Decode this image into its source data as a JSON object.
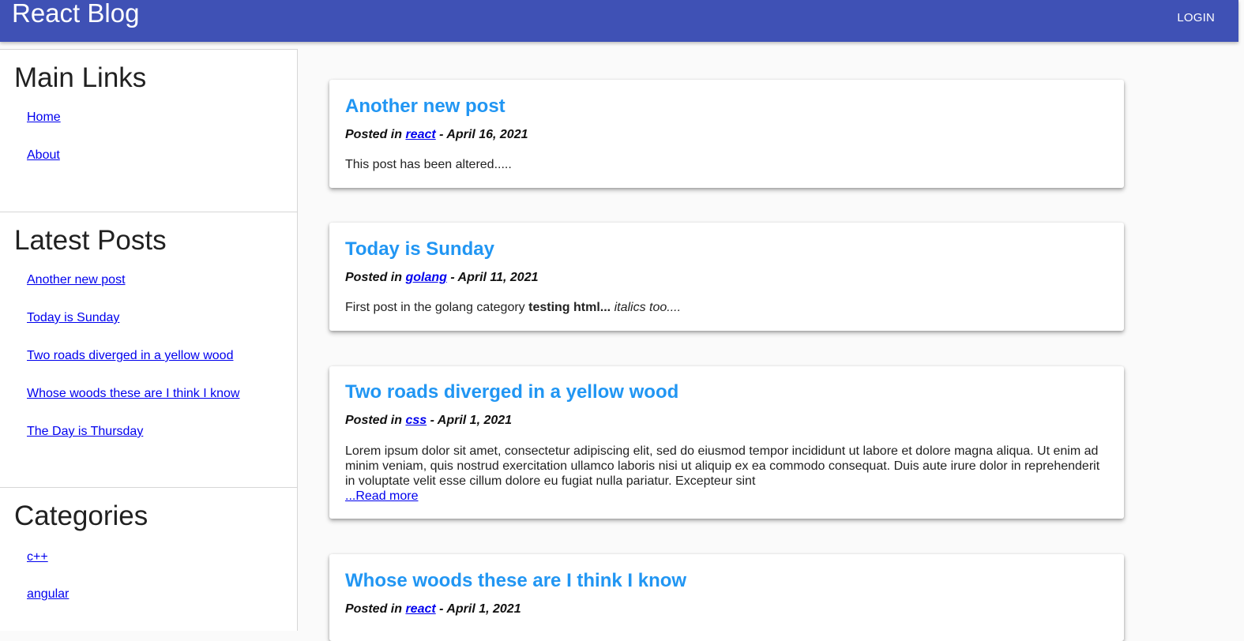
{
  "appbar": {
    "title": "React Blog",
    "login_label": "LOGIN"
  },
  "sidebar": {
    "main_links": {
      "heading": "Main Links",
      "items": [
        {
          "label": "Home"
        },
        {
          "label": "About"
        }
      ]
    },
    "latest_posts": {
      "heading": "Latest Posts",
      "items": [
        {
          "label": "Another new post"
        },
        {
          "label": "Today is Sunday"
        },
        {
          "label": "Two roads diverged in a yellow wood"
        },
        {
          "label": "Whose woods these are I think I know"
        },
        {
          "label": "The Day is Thursday"
        }
      ]
    },
    "categories": {
      "heading": "Categories",
      "items": [
        {
          "label": "c++"
        },
        {
          "label": "angular"
        }
      ]
    }
  },
  "posts": [
    {
      "title": "Another new post",
      "meta_prefix": "Posted in ",
      "category": "react",
      "meta_suffix": " - April 16, 2021",
      "body_plain": "This post has been altered....."
    },
    {
      "title": "Today is Sunday",
      "meta_prefix": "Posted in ",
      "category": "golang",
      "meta_suffix": " - April 11, 2021",
      "body_plain": "First post in the golang category ",
      "body_bold": "testing html...",
      "body_italic": " italics too...."
    },
    {
      "title": "Two roads diverged in a yellow wood",
      "meta_prefix": "Posted in ",
      "category": "css",
      "meta_suffix": " - April 1, 2021",
      "body_plain": "Lorem ipsum dolor sit amet, consectetur adipiscing elit, sed do eiusmod tempor incididunt ut labore et dolore magna aliqua. Ut enim ad minim veniam, quis nostrud exercitation ullamco laboris nisi ut aliquip ex ea commodo consequat. Duis aute irure dolor in reprehenderit in voluptate velit esse cillum dolore eu fugiat nulla pariatur. Excepteur sint",
      "read_more": "...Read more"
    },
    {
      "title": "Whose woods these are I think I know",
      "meta_prefix": "Posted in ",
      "category": "react",
      "meta_suffix": " - April 1, 2021"
    }
  ],
  "colors": {
    "appbar": "#3f51b5",
    "post_title": "#2196f3",
    "link": "#0000ee"
  }
}
